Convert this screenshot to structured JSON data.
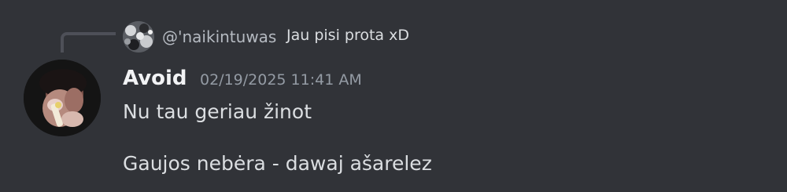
{
  "reply": {
    "author": "@'naikintuwas",
    "content": "Jau pisi prota xD",
    "avatar_icon": "user-avatar"
  },
  "message": {
    "author": "Avoid",
    "timestamp": "02/19/2025 11:41 AM",
    "avatar_icon": "user-avatar",
    "lines": [
      "Nu tau geriau žinot",
      "Gaujos nebėra - dawaj ašarelez"
    ]
  },
  "colors": {
    "background": "#313338",
    "author": "#f2f3f5",
    "text": "#dbdee1",
    "muted": "#949ba4",
    "spine": "#4e5058"
  }
}
